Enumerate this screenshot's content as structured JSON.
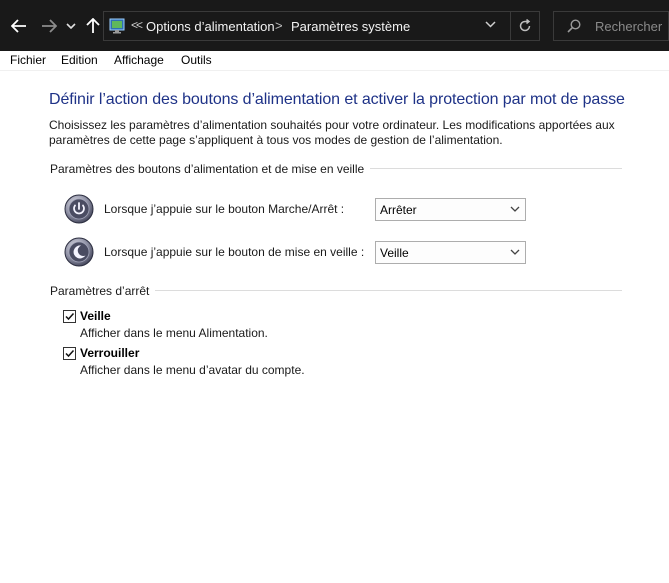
{
  "address_bar": {
    "breadcrumb": [
      "Options d’alimentation",
      "Paramètres système"
    ],
    "search_placeholder": "Rechercher"
  },
  "menu": [
    "Fichier",
    "Edition",
    "Affichage",
    "Outils"
  ],
  "main": {
    "title": "Définir l’action des boutons d’alimentation et activer la protection par mot de passe",
    "description": "Choisissez les paramètres d’alimentation souhaités pour votre ordinateur. Les modifications apportées aux paramètres de cette page s’appliquent à tous vos modes de gestion de l’alimentation.",
    "buttons_group": {
      "heading": "Paramètres des boutons d’alimentation et de mise en veille",
      "rows": [
        {
          "label": "Lorsque j’appuie sur le bouton Marche/Arrêt :",
          "value": "Arrêter",
          "icon": "power-button-icon"
        },
        {
          "label": "Lorsque j’appuie sur le bouton de mise en veille :",
          "value": "Veille",
          "icon": "sleep-button-icon"
        }
      ]
    },
    "shutdown_group": {
      "heading": "Paramètres d’arrêt",
      "options": [
        {
          "label": "Veille",
          "description": "Afficher dans le menu Alimentation.",
          "checked": true
        },
        {
          "label": "Verrouiller",
          "description": "Afficher dans le menu d’avatar du compte.",
          "checked": true
        }
      ]
    }
  },
  "colors": {
    "topbar_bg": "#191919",
    "title_blue": "#1e3287"
  }
}
